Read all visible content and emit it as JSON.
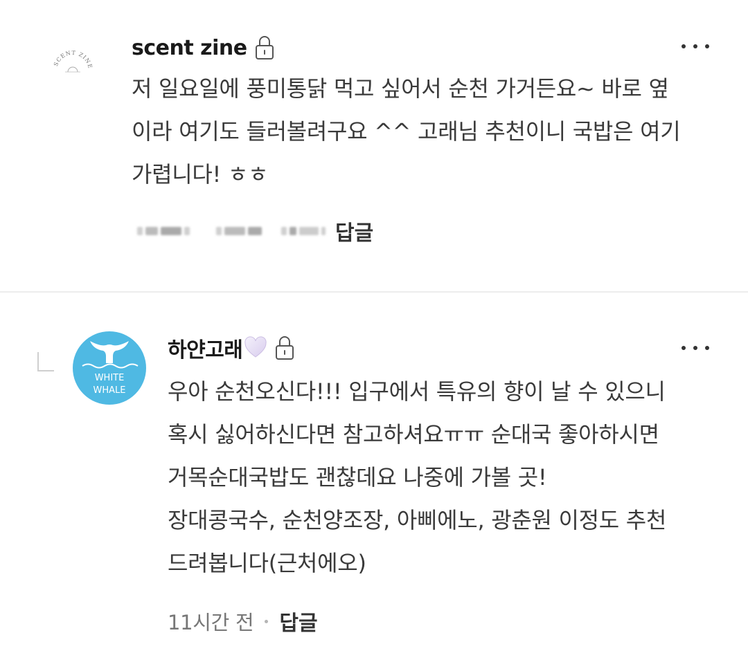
{
  "comments": [
    {
      "author": "scent zine",
      "avatar_icon": "scent-zine-logo-icon",
      "locked": true,
      "lines": [
        "저 일요일에 풍미통닭 먹고 싶어서 순천 가거든요~ 바로 옆",
        "이라 여기도 들러볼려구요 ^^ 고래님 추천이니 국밥은 여기",
        "가렵니다! ㅎㅎ"
      ],
      "time": "",
      "time_blurred": true,
      "reply_label": "답글"
    },
    {
      "author": "하얀고래",
      "author_icon": "white-heart-icon",
      "avatar_icon": "white-whale-logo-icon",
      "avatar_text": [
        "WHITE",
        "WHALE"
      ],
      "is_reply": true,
      "locked": true,
      "lines": [
        "우아 순천오신다!!! 입구에서 특유의 향이 날 수 있으니",
        "혹시 싫어하신다면 참고하셔요ㅠㅠ 순대국 좋아하시면",
        "거목순대국밥도 괜찮데요 나중에 가볼 곳!",
        "장대콩국수, 순천양조장, 아삐에노, 광춘원 이정도 추천",
        "드려봅니다(근처에오)"
      ],
      "time": "11시간 전",
      "reply_label": "답글"
    }
  ],
  "colors": {
    "whale_avatar_bg": "#4fb9e3",
    "text": "#3a3a3a",
    "muted": "#777777"
  }
}
